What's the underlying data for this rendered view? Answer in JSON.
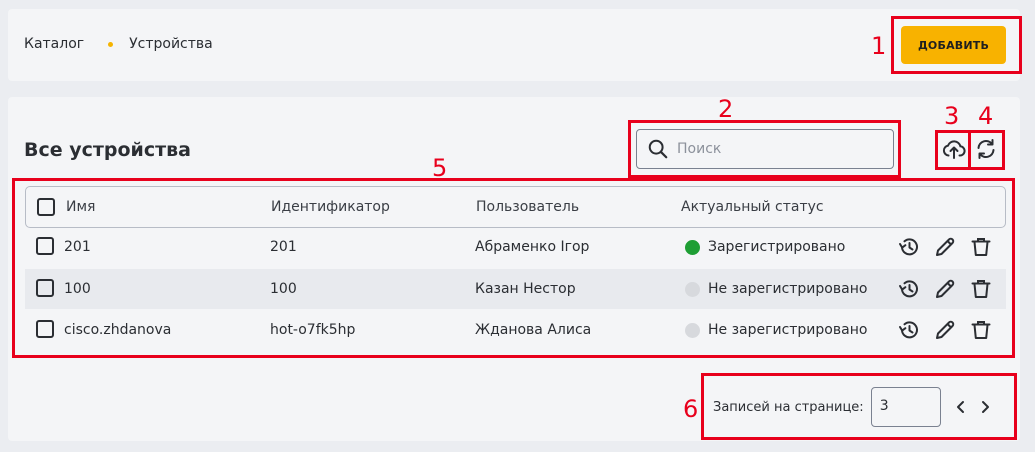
{
  "breadcrumb": {
    "root": "Каталог",
    "current": "Устройства"
  },
  "toolbar": {
    "add_label": "ДОБАВИТЬ"
  },
  "page": {
    "title": "Все устройства"
  },
  "search": {
    "placeholder": "Поиск"
  },
  "table": {
    "columns": [
      "Имя",
      "Идентификатор",
      "Пользователь",
      "Актуальный статус"
    ],
    "rows": [
      {
        "name": "201",
        "id": "201",
        "user": "Абраменко Ігор",
        "status": "Зарегистрировано",
        "status_color": "#1e9e34"
      },
      {
        "name": "100",
        "id": "100",
        "user": "Казан Нестор",
        "status": "Не зарегистрировано",
        "status_color": "#d7d9dd"
      },
      {
        "name": "cisco.zhdanova",
        "id": "hot-o7fk5hp",
        "user": "Жданова Алиса",
        "status": "Не зарегистрировано",
        "status_color": "#d7d9dd"
      }
    ]
  },
  "pagination": {
    "label": "Записей на странице:",
    "per_page": "3"
  },
  "annotations": [
    "1",
    "2",
    "3",
    "4",
    "5",
    "6"
  ],
  "colors": {
    "accent": "#f8b200",
    "annotation": "#e8001c",
    "online": "#1e9e34",
    "offline": "#d7d9dd"
  },
  "icons": [
    "search-icon",
    "upload-icon",
    "refresh-icon",
    "history-icon",
    "edit-icon",
    "trash-icon",
    "chevron-left-icon",
    "chevron-right-icon"
  ]
}
